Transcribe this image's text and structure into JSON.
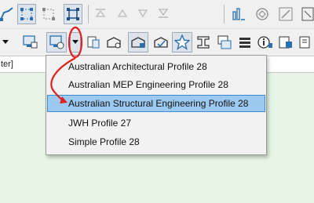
{
  "filter_bar": {
    "text": "ter]"
  },
  "profile_menu": {
    "items": [
      {
        "label": "Australian Architectural Profile 28",
        "selected": false
      },
      {
        "label": "Australian MEP Engineering Profile 28",
        "selected": false
      },
      {
        "label": "Australian Structural Engineering Profile 28",
        "selected": true
      },
      {
        "label": "JWH Profile 27",
        "selected": false
      },
      {
        "label": "Simple Profile 28",
        "selected": false
      }
    ]
  },
  "annotation": {
    "color": "#e02020"
  },
  "colors": {
    "canvas_bg": "#e6f5e6",
    "selected_item": "#9cc9ef",
    "selected_border": "#3d8ad2"
  }
}
